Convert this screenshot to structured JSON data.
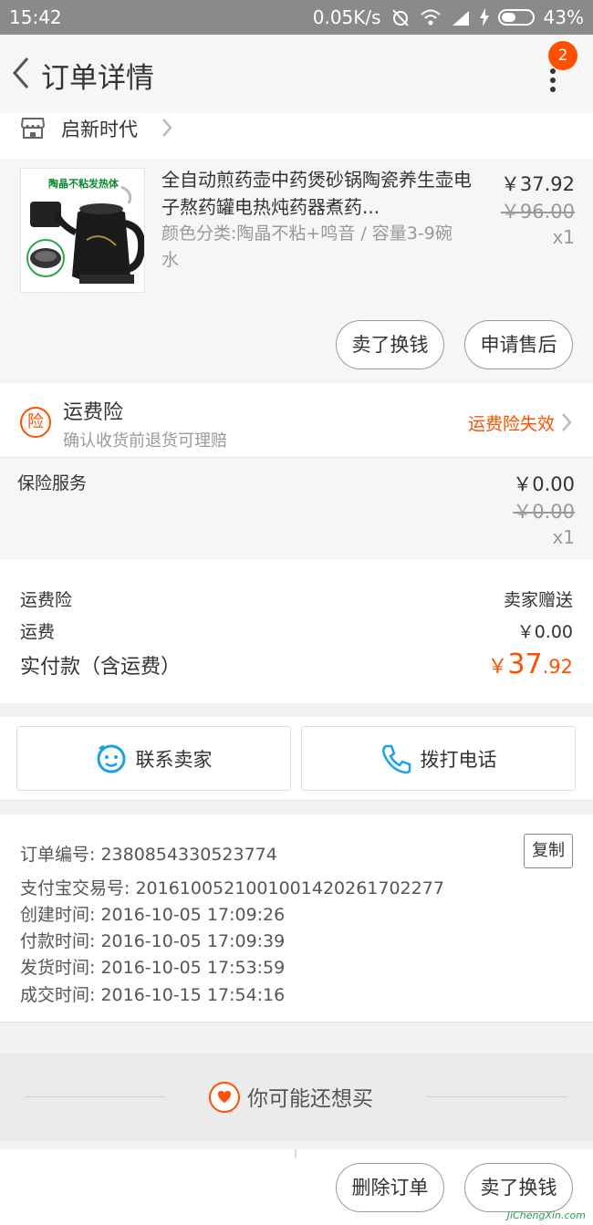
{
  "status_bar": {
    "time": "15:42",
    "network_speed": "0.05K/s",
    "battery": "43%"
  },
  "header": {
    "title": "订单详情",
    "badge_count": "2"
  },
  "shop": {
    "name": "启新时代"
  },
  "product": {
    "thumb_label": "陶晶不粘发热体",
    "title": "全自动煎药壶中药煲砂锅陶瓷养生壶电子熬药罐电热炖药器煮药...",
    "sku": "颜色分类:陶晶不粘+鸣音 / 容量3-9碗水",
    "price": "￥37.92",
    "original_price": "￥96.00",
    "qty": "x1",
    "btn_resell": "卖了换钱",
    "btn_aftersale": "申请售后"
  },
  "shipping_insurance": {
    "title": "运费险",
    "subtitle": "确认收货前退货可理赔",
    "status": "运费险失效",
    "icon_char": "险"
  },
  "protection_service": {
    "label": "保险服务",
    "price": "￥0.00",
    "original_price": "￥0.00",
    "qty": "x1"
  },
  "summary": {
    "row1_label": "运费险",
    "row1_value": "卖家赠送",
    "row2_label": "运费",
    "row2_value": "￥0.00",
    "total_label": "实付款（含运费）",
    "total_currency": "￥",
    "total_int": "37",
    "total_dec": ".92"
  },
  "contact": {
    "seller_label": "联系卖家",
    "call_label": "拨打电话"
  },
  "order_info": {
    "order_no": "订单编号: 2380854330523774",
    "copy_label": "复制",
    "alipay_no": "支付宝交易号: 2016100521001001420261702277",
    "created": "创建时间: 2016-10-05 17:09:26",
    "paid": "付款时间: 2016-10-05 17:09:39",
    "shipped": "发货时间: 2016-10-05 17:53:59",
    "completed": "成交时间: 2016-10-15 17:54:16"
  },
  "recommend": {
    "title": "你可能还想买"
  },
  "bottom_bar": {
    "delete_label": "删除订单",
    "resell_label": "卖了换钱"
  },
  "watermark": "JiChengXin.com",
  "colors": {
    "accent": "#ff5000",
    "contact_icon": "#1aa1e6"
  }
}
